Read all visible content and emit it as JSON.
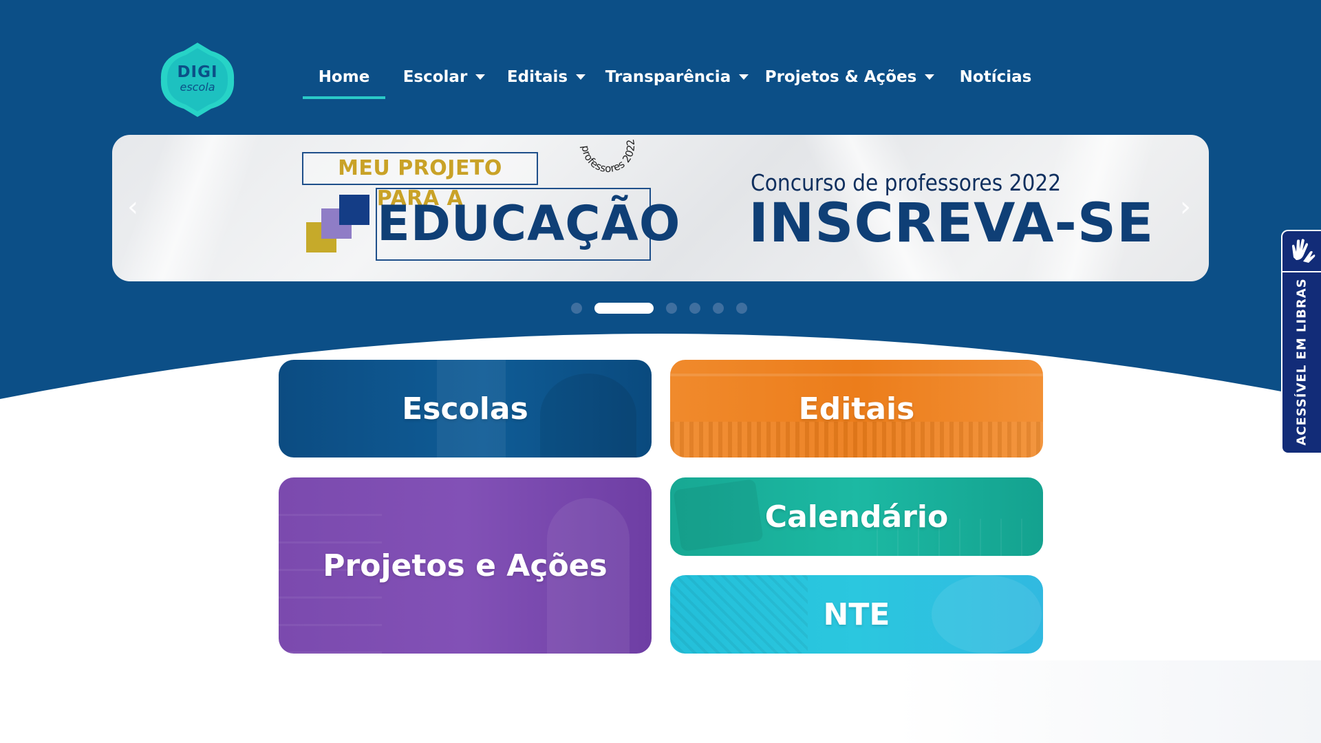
{
  "brand": {
    "logo_line1": "DIGI",
    "logo_line2": "escola",
    "colors": {
      "primary": "#0c4f87",
      "accent": "#2ac9c7"
    }
  },
  "nav": {
    "items": [
      {
        "label": "Home",
        "active": true,
        "dropdown": false
      },
      {
        "label": "Escolar",
        "dropdown": true
      },
      {
        "label": "Editais",
        "dropdown": true
      },
      {
        "label": "Transparência",
        "dropdown": true
      },
      {
        "label": "Projetos & Ações",
        "dropdown": true
      },
      {
        "label": "Notícias",
        "dropdown": false
      }
    ]
  },
  "slider": {
    "kicker": "MEU PROJETO PARA A",
    "title": "EDUCAÇÃO",
    "stamp_text": "professores 2022",
    "subtitle": "Concurso de professores 2022",
    "cta": "INSCREVA-SE",
    "prev_icon": "chevron-left-icon",
    "next_icon": "chevron-right-icon",
    "dots_total": 6,
    "active_dot": 2
  },
  "tiles": [
    {
      "label": "Escolas",
      "color": "#0d4f86"
    },
    {
      "label": "Editais",
      "color": "#ef7d1f"
    },
    {
      "label": "Projetos e Ações",
      "color": "#7e4cb0"
    },
    {
      "label": "Calendário",
      "color": "#17b39f"
    },
    {
      "label": "NTE",
      "color": "#27c3dc"
    }
  ],
  "accessibility": {
    "label": "ACESSÍVEL EM LIBRAS",
    "icon": "sign-language-hands-icon"
  }
}
